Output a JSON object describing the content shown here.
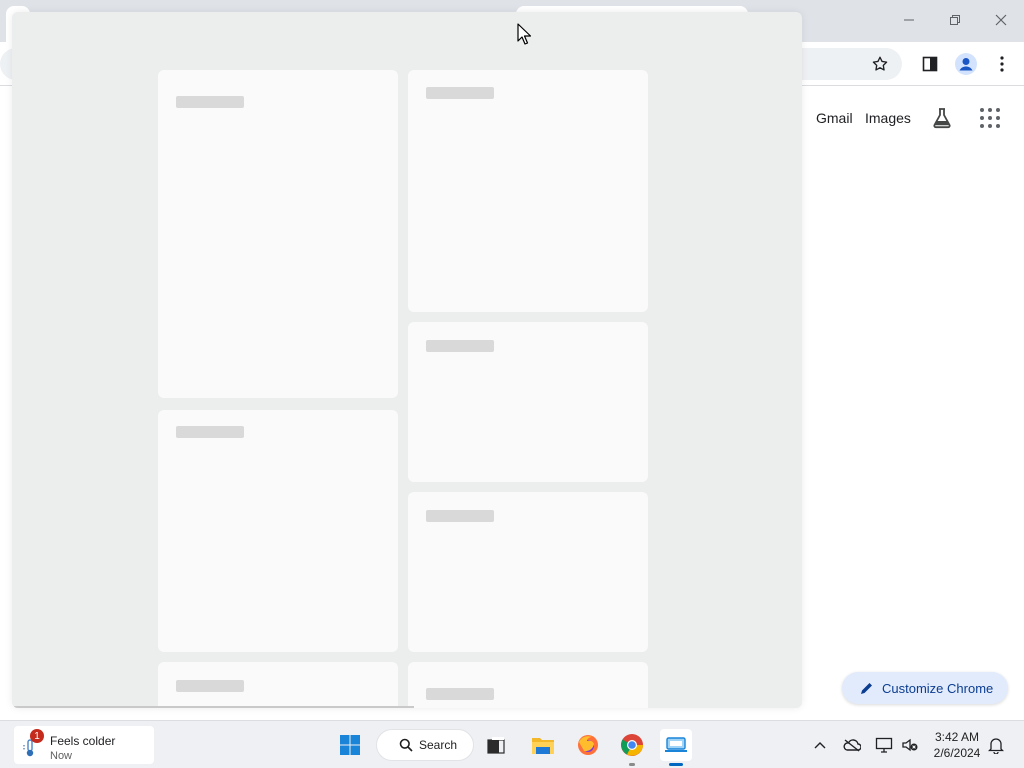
{
  "chrome": {
    "window_controls": {
      "minimize_icon": "minimize-icon",
      "restore_icon": "restore-icon",
      "close_icon": "close-icon"
    },
    "toolbar_icons": [
      "star-icon",
      "side-panel-icon",
      "profile-icon",
      "menu-icon"
    ]
  },
  "new_tab_page": {
    "gmail_label": "Gmail",
    "images_label": "Images",
    "labs_icon": "labs-flask-icon",
    "apps_icon": "apps-grid-icon",
    "customize_label": "Customize Chrome",
    "customize_icon": "pencil-icon"
  },
  "overlay": {
    "state": "loading",
    "card_count": 8
  },
  "taskbar": {
    "widget": {
      "badge": "1",
      "title": "Feels colder",
      "subtitle": "Now"
    },
    "search_label": "Search",
    "apps": [
      "start-icon",
      "search-icon",
      "task-view-icon",
      "file-explorer-icon",
      "firefox-icon",
      "chrome-icon",
      "active-app-icon"
    ],
    "tray": [
      "chevron-up-icon",
      "onedrive-icon",
      "network-icon",
      "volume-muted-icon",
      "notification-bell-icon"
    ],
    "clock": {
      "time": "3:42 AM",
      "date": "2/6/2024"
    }
  },
  "colors": {
    "accent": "#0067c0",
    "badge": "#c42b1c",
    "customize_bg": "#e2ebfb"
  }
}
